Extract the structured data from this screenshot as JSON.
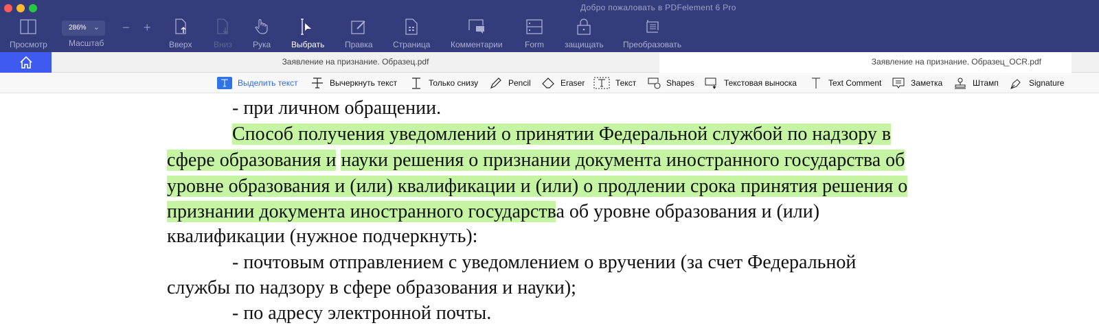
{
  "window": {
    "title": "Добро пожаловать в PDFelement 6 Pro"
  },
  "toolbar": {
    "view": "Просмотр",
    "zoom_value": "286%",
    "zoom_label": "Масштаб",
    "zoom_out": "−",
    "zoom_in": "+",
    "up": "Вверх",
    "down": "Вниз",
    "hand": "Рука",
    "select": "Выбрать",
    "edit": "Правка",
    "page": "Страница",
    "comments": "Комментарии",
    "form": "Form",
    "protect": "защищать",
    "convert": "Преобразовать"
  },
  "tabs": [
    {
      "label": "Заявление на признание. Образец.pdf"
    },
    {
      "label": "Заявление на признание. Образец_OCR.pdf"
    }
  ],
  "annotations": [
    "Выделить текст",
    "Вычеркнуть текст",
    "Только снизу",
    "Pencil",
    "Eraser",
    "Текст",
    "Shapes",
    "Текстовая выноска",
    "Text Comment",
    "Заметка",
    "Штамп",
    "Signature"
  ],
  "colors": {
    "toolbar": "#343c7b",
    "accent": "#3e5af0",
    "highlight": "#c5f5a2"
  },
  "document": {
    "l0": "- при личном обращении.",
    "l1": "Способ получения уведомлений о принятии Федеральной службой по надзору в",
    "l2a": "сфере образования и",
    "l2b": "науки решения о признании документа иностранного государства об",
    "l3": "уровне образования и (или) квалификации и (или) о продлении срока принятия решения о",
    "l4a": "признании документа иностранного государств",
    "l4b": "а об уровне образования и (или)",
    "l5": "квалификации (нужное подчеркнуть):",
    "l6": "- почтовым отправлением с уведомлением о вручении (за счет Федеральной",
    "l7": "службы по надзору в сфере образования и науки);",
    "l8": "- по адресу электронной почты."
  }
}
